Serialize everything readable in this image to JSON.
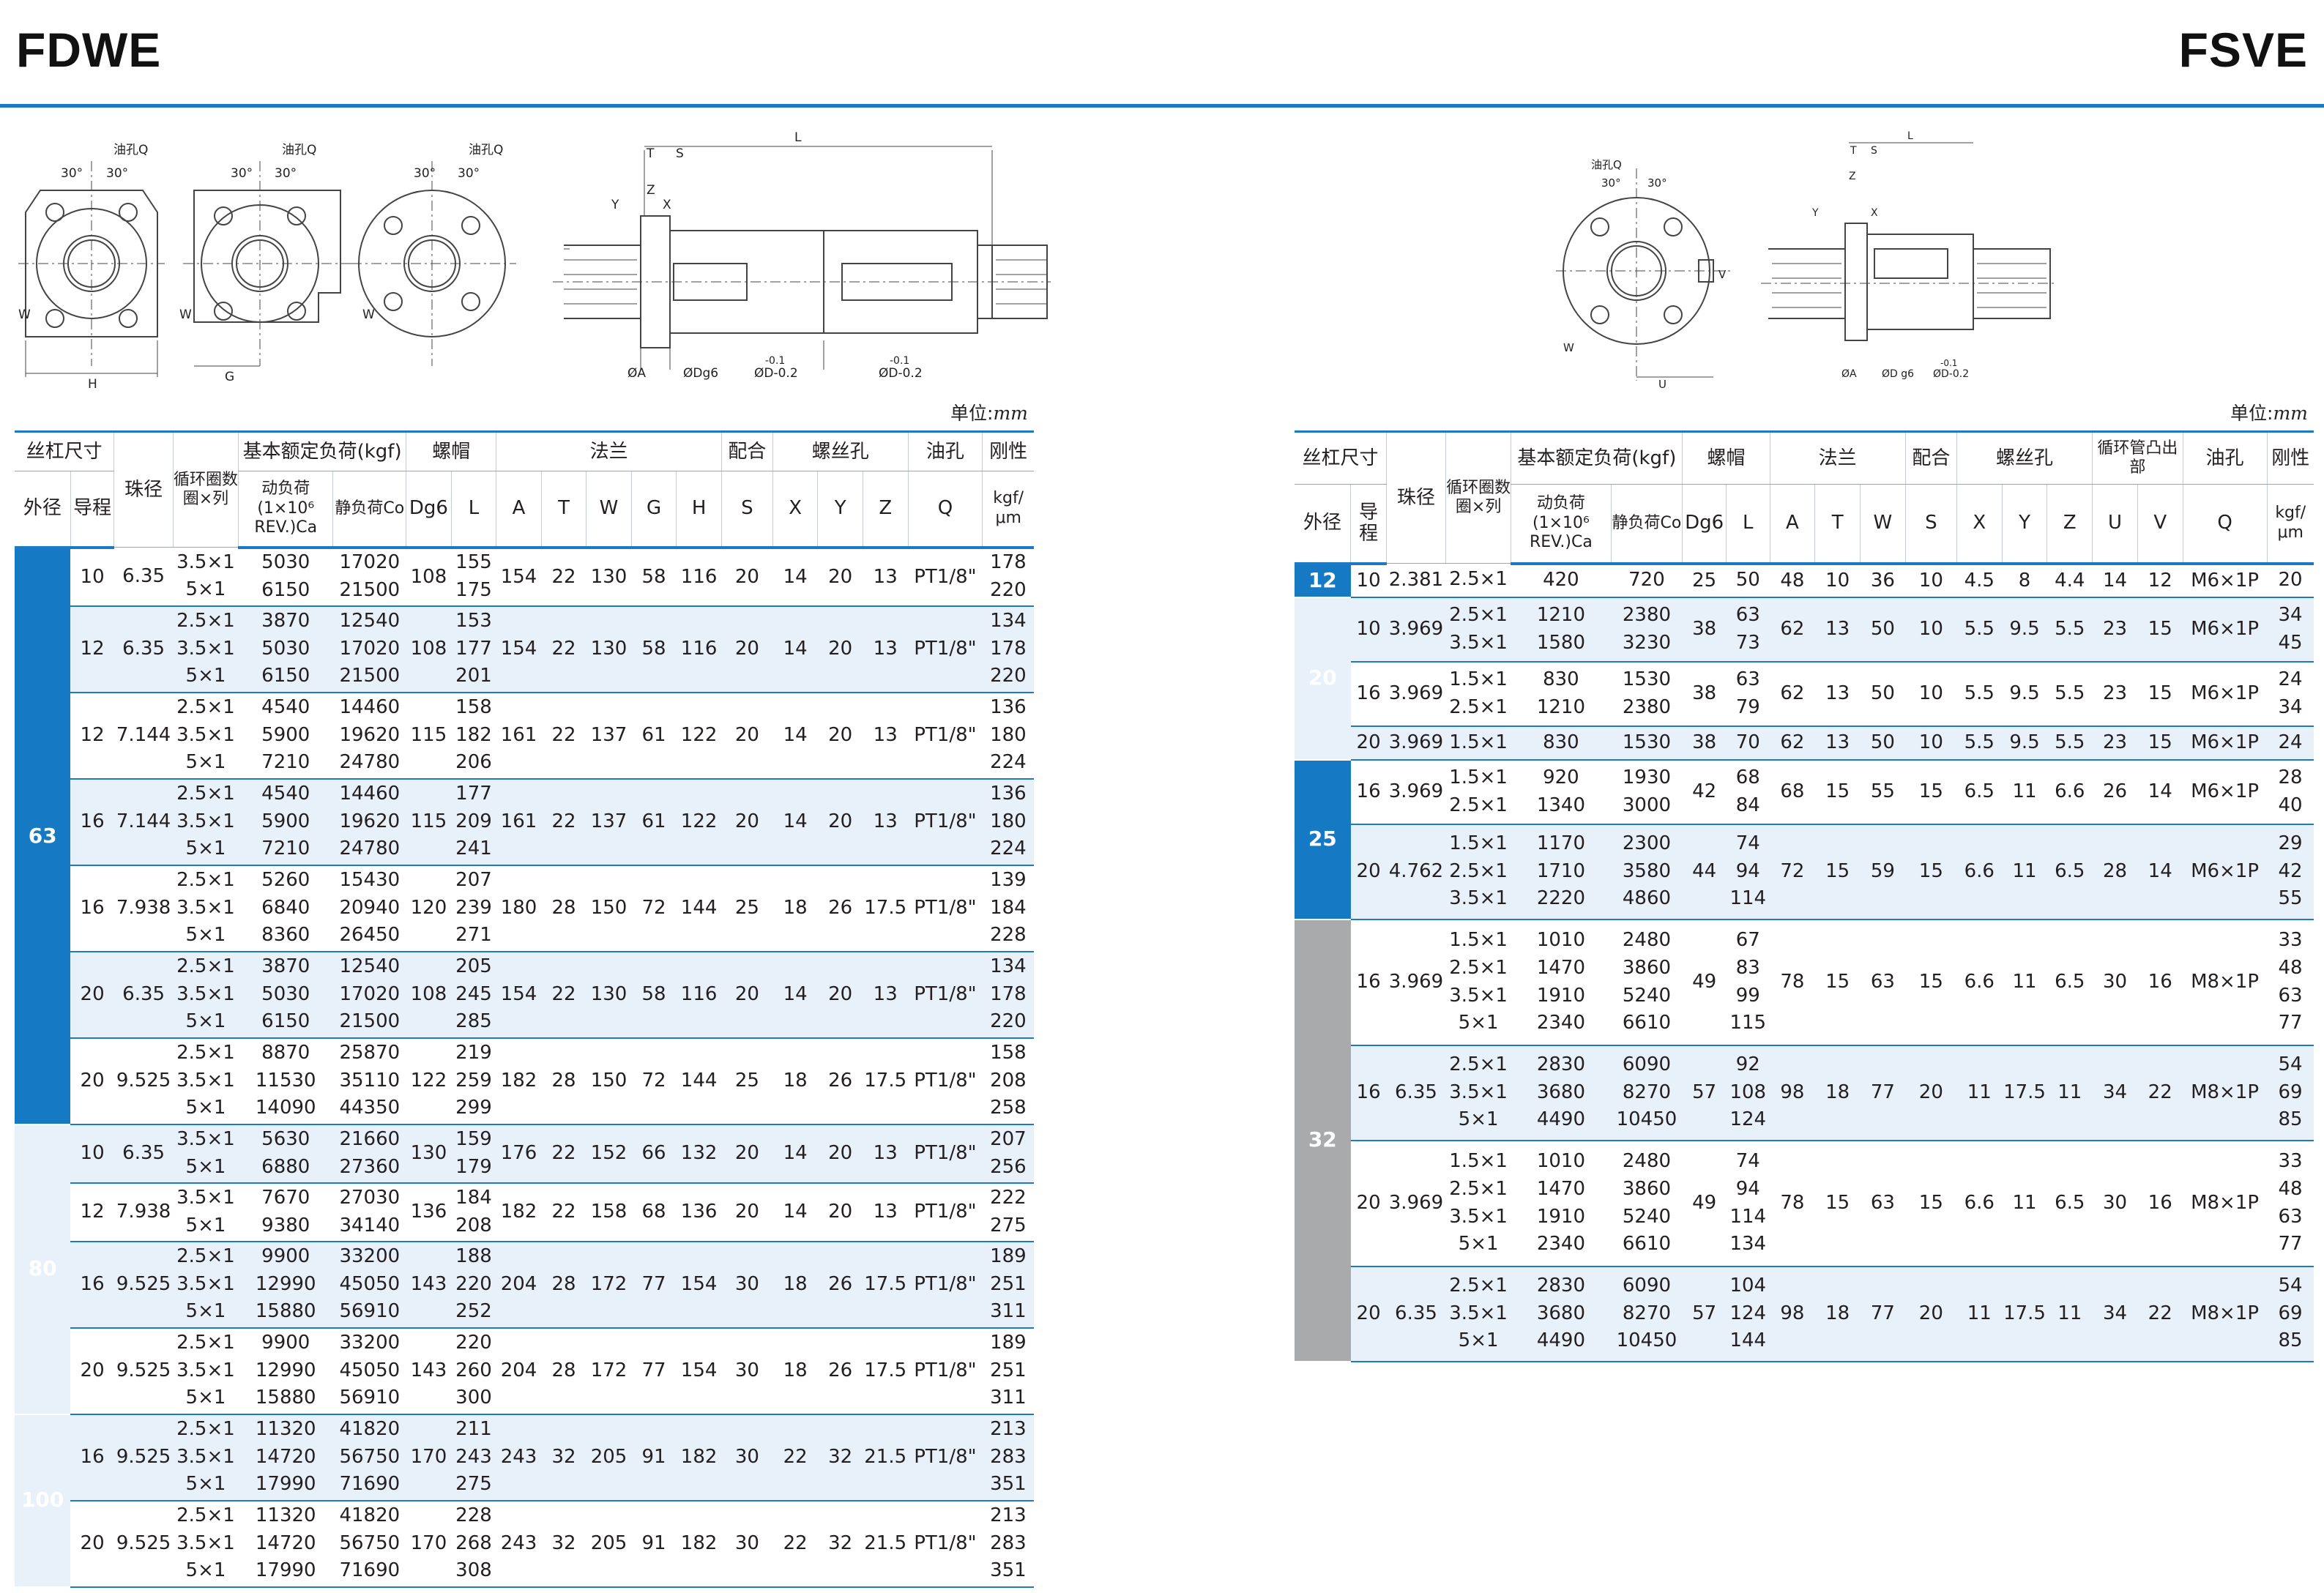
{
  "titles": {
    "left": "FDWE",
    "right": "FSVE"
  },
  "unit": {
    "label": "单位:",
    "value": "mm"
  },
  "drawing_labels": {
    "oil_hole": "油孔Q",
    "angle": "30°",
    "W": "W",
    "H": "H",
    "G": "G",
    "L": "L",
    "T": "T",
    "S": "S",
    "Z": "Z",
    "Y": "Y",
    "X": "X",
    "U": "U",
    "V": "V",
    "phiA": "ØA",
    "phiDg6": "ØDg6",
    "phiDg6_right": "ØD g6",
    "phiD": "ØD-0.2",
    "tol": "-0.1"
  },
  "header_left": {
    "screw": "丝杠尺寸",
    "od": "外径",
    "lead": "导程",
    "ball": "珠径",
    "circ": "循环圈数圈×列",
    "load": "基本额定负荷(kgf)",
    "dyn": "动负荷(1×10⁶ REV.)Ca",
    "stat": "静负荷Co",
    "nut": "螺帽",
    "Dg6": "Dg6",
    "L": "L",
    "flange": "法兰",
    "A": "A",
    "T": "T",
    "W": "W",
    "G": "G",
    "H": "H",
    "fit": "配合",
    "S": "S",
    "bolt": "螺丝孔",
    "X": "X",
    "Y": "Y",
    "Z": "Z",
    "oil": "油孔",
    "Q": "Q",
    "rig": "刚性",
    "rigu": "kgf/μm"
  },
  "header_right": {
    "screw": "丝杠尺寸",
    "od": "外径",
    "lead": "导程",
    "ball": "珠径",
    "circ": "循环圈数圈×列",
    "load": "基本额定负荷(kgf)",
    "dyn": "动负荷(1×10⁶ REV.)Ca",
    "stat": "静负荷Co",
    "nut": "螺帽",
    "Dg6": "Dg6",
    "L": "L",
    "flange": "法兰",
    "A": "A",
    "T": "T",
    "W": "W",
    "fit": "配合",
    "S": "S",
    "bolt": "螺丝孔",
    "X": "X",
    "Y": "Y",
    "Z": "Z",
    "ret": "循环管凸出部",
    "U": "U",
    "V": "V",
    "oil": "油孔",
    "Q": "Q",
    "rig": "刚性",
    "rigu": "kgf/μm"
  },
  "fdwe_groups": [
    {
      "od": "63",
      "color": "blue",
      "rows": [
        {
          "lead": "10",
          "ball": "6.35",
          "circ": [
            "3.5×1",
            "5×1"
          ],
          "ca": [
            "5030",
            "6150"
          ],
          "co": [
            "17020",
            "21500"
          ],
          "D": "108",
          "L": [
            "155",
            "175"
          ],
          "A": "154",
          "T": "22",
          "W": "130",
          "G": "58",
          "H": "116",
          "S": "20",
          "X": "14",
          "Y": "20",
          "Z": "13",
          "Q": "PT1/8\"",
          "K": [
            "178",
            "220"
          ]
        },
        {
          "lead": "12",
          "ball": "6.35",
          "circ": [
            "2.5×1",
            "3.5×1",
            "5×1"
          ],
          "ca": [
            "3870",
            "5030",
            "6150"
          ],
          "co": [
            "12540",
            "17020",
            "21500"
          ],
          "D": "108",
          "L": [
            "153",
            "177",
            "201"
          ],
          "A": "154",
          "T": "22",
          "W": "130",
          "G": "58",
          "H": "116",
          "S": "20",
          "X": "14",
          "Y": "20",
          "Z": "13",
          "Q": "PT1/8\"",
          "K": [
            "134",
            "178",
            "220"
          ]
        },
        {
          "lead": "12",
          "ball": "7.144",
          "circ": [
            "2.5×1",
            "3.5×1",
            "5×1"
          ],
          "ca": [
            "4540",
            "5900",
            "7210"
          ],
          "co": [
            "14460",
            "19620",
            "24780"
          ],
          "D": "115",
          "L": [
            "158",
            "182",
            "206"
          ],
          "A": "161",
          "T": "22",
          "W": "137",
          "G": "61",
          "H": "122",
          "S": "20",
          "X": "14",
          "Y": "20",
          "Z": "13",
          "Q": "PT1/8\"",
          "K": [
            "136",
            "180",
            "224"
          ]
        },
        {
          "lead": "16",
          "ball": "7.144",
          "circ": [
            "2.5×1",
            "3.5×1",
            "5×1"
          ],
          "ca": [
            "4540",
            "5900",
            "7210"
          ],
          "co": [
            "14460",
            "19620",
            "24780"
          ],
          "D": "115",
          "L": [
            "177",
            "209",
            "241"
          ],
          "A": "161",
          "T": "22",
          "W": "137",
          "G": "61",
          "H": "122",
          "S": "20",
          "X": "14",
          "Y": "20",
          "Z": "13",
          "Q": "PT1/8\"",
          "K": [
            "136",
            "180",
            "224"
          ]
        },
        {
          "lead": "16",
          "ball": "7.938",
          "circ": [
            "2.5×1",
            "3.5×1",
            "5×1"
          ],
          "ca": [
            "5260",
            "6840",
            "8360"
          ],
          "co": [
            "15430",
            "20940",
            "26450"
          ],
          "D": "120",
          "L": [
            "207",
            "239",
            "271"
          ],
          "A": "180",
          "T": "28",
          "W": "150",
          "G": "72",
          "H": "144",
          "S": "25",
          "X": "18",
          "Y": "26",
          "Z": "17.5",
          "Q": "PT1/8\"",
          "K": [
            "139",
            "184",
            "228"
          ]
        },
        {
          "lead": "20",
          "ball": "6.35",
          "circ": [
            "2.5×1",
            "3.5×1",
            "5×1"
          ],
          "ca": [
            "3870",
            "5030",
            "6150"
          ],
          "co": [
            "12540",
            "17020",
            "21500"
          ],
          "D": "108",
          "L": [
            "205",
            "245",
            "285"
          ],
          "A": "154",
          "T": "22",
          "W": "130",
          "G": "58",
          "H": "116",
          "S": "20",
          "X": "14",
          "Y": "20",
          "Z": "13",
          "Q": "PT1/8\"",
          "K": [
            "134",
            "178",
            "220"
          ]
        },
        {
          "lead": "20",
          "ball": "9.525",
          "circ": [
            "2.5×1",
            "3.5×1",
            "5×1"
          ],
          "ca": [
            "8870",
            "11530",
            "14090"
          ],
          "co": [
            "25870",
            "35110",
            "44350"
          ],
          "D": "122",
          "L": [
            "219",
            "259",
            "299"
          ],
          "A": "182",
          "T": "28",
          "W": "150",
          "G": "72",
          "H": "144",
          "S": "25",
          "X": "18",
          "Y": "26",
          "Z": "17.5",
          "Q": "PT1/8\"",
          "K": [
            "158",
            "208",
            "258"
          ]
        }
      ]
    },
    {
      "od": "80",
      "color": "gray",
      "rows": [
        {
          "lead": "10",
          "ball": "6.35",
          "circ": [
            "3.5×1",
            "5×1"
          ],
          "ca": [
            "5630",
            "6880"
          ],
          "co": [
            "21660",
            "27360"
          ],
          "D": "130",
          "L": [
            "159",
            "179"
          ],
          "A": "176",
          "T": "22",
          "W": "152",
          "G": "66",
          "H": "132",
          "S": "20",
          "X": "14",
          "Y": "20",
          "Z": "13",
          "Q": "PT1/8\"",
          "K": [
            "207",
            "256"
          ]
        },
        {
          "lead": "12",
          "ball": "7.938",
          "circ": [
            "3.5×1",
            "5×1"
          ],
          "ca": [
            "7670",
            "9380"
          ],
          "co": [
            "27030",
            "34140"
          ],
          "D": "136",
          "L": [
            "184",
            "208"
          ],
          "A": "182",
          "T": "22",
          "W": "158",
          "G": "68",
          "H": "136",
          "S": "20",
          "X": "14",
          "Y": "20",
          "Z": "13",
          "Q": "PT1/8\"",
          "K": [
            "222",
            "275"
          ]
        },
        {
          "lead": "16",
          "ball": "9.525",
          "circ": [
            "2.5×1",
            "3.5×1",
            "5×1"
          ],
          "ca": [
            "9900",
            "12990",
            "15880"
          ],
          "co": [
            "33200",
            "45050",
            "56910"
          ],
          "D": "143",
          "L": [
            "188",
            "220",
            "252"
          ],
          "A": "204",
          "T": "28",
          "W": "172",
          "G": "77",
          "H": "154",
          "S": "30",
          "X": "18",
          "Y": "26",
          "Z": "17.5",
          "Q": "PT1/8\"",
          "K": [
            "189",
            "251",
            "311"
          ]
        },
        {
          "lead": "20",
          "ball": "9.525",
          "circ": [
            "2.5×1",
            "3.5×1",
            "5×1"
          ],
          "ca": [
            "9900",
            "12990",
            "15880"
          ],
          "co": [
            "33200",
            "45050",
            "56910"
          ],
          "D": "143",
          "L": [
            "220",
            "260",
            "300"
          ],
          "A": "204",
          "T": "28",
          "W": "172",
          "G": "77",
          "H": "154",
          "S": "30",
          "X": "18",
          "Y": "26",
          "Z": "17.5",
          "Q": "PT1/8\"",
          "K": [
            "189",
            "251",
            "311"
          ]
        }
      ]
    },
    {
      "od": "100",
      "color": "blue",
      "rows": [
        {
          "lead": "16",
          "ball": "9.525",
          "circ": [
            "2.5×1",
            "3.5×1",
            "5×1"
          ],
          "ca": [
            "11320",
            "14720",
            "17990"
          ],
          "co": [
            "41820",
            "56750",
            "71690"
          ],
          "D": "170",
          "L": [
            "211",
            "243",
            "275"
          ],
          "A": "243",
          "T": "32",
          "W": "205",
          "G": "91",
          "H": "182",
          "S": "30",
          "X": "22",
          "Y": "32",
          "Z": "21.5",
          "Q": "PT1/8\"",
          "K": [
            "213",
            "283",
            "351"
          ]
        },
        {
          "lead": "20",
          "ball": "9.525",
          "circ": [
            "2.5×1",
            "3.5×1",
            "5×1"
          ],
          "ca": [
            "11320",
            "14720",
            "17990"
          ],
          "co": [
            "41820",
            "56750",
            "71690"
          ],
          "D": "170",
          "L": [
            "228",
            "268",
            "308"
          ],
          "A": "243",
          "T": "32",
          "W": "205",
          "G": "91",
          "H": "182",
          "S": "30",
          "X": "22",
          "Y": "32",
          "Z": "21.5",
          "Q": "PT1/8\"",
          "K": [
            "213",
            "283",
            "351"
          ]
        }
      ]
    }
  ],
  "fsve_groups": [
    {
      "od": "12",
      "color": "blue",
      "rows": [
        {
          "lead": "10",
          "ball": "2.381",
          "circ": [
            "2.5×1"
          ],
          "ca": [
            "420"
          ],
          "co": [
            "720"
          ],
          "D": "25",
          "L": [
            "50"
          ],
          "A": "48",
          "T": "10",
          "W": "36",
          "S": "10",
          "X": "4.5",
          "Y": "8",
          "Z": "4.4",
          "U": "14",
          "V": "12",
          "Q": "M6×1P",
          "K": [
            "20"
          ]
        }
      ]
    },
    {
      "od": "20",
      "color": "gray",
      "rows": [
        {
          "lead": "10",
          "ball": "3.969",
          "circ": [
            "2.5×1",
            "3.5×1"
          ],
          "ca": [
            "1210",
            "1580"
          ],
          "co": [
            "2380",
            "3230"
          ],
          "D": "38",
          "L": [
            "63",
            "73"
          ],
          "A": "62",
          "T": "13",
          "W": "50",
          "S": "10",
          "X": "5.5",
          "Y": "9.5",
          "Z": "5.5",
          "U": "23",
          "V": "15",
          "Q": "M6×1P",
          "K": [
            "34",
            "45"
          ]
        },
        {
          "lead": "16",
          "ball": "3.969",
          "circ": [
            "1.5×1",
            "2.5×1"
          ],
          "ca": [
            "830",
            "1210"
          ],
          "co": [
            "1530",
            "2380"
          ],
          "D": "38",
          "L": [
            "63",
            "79"
          ],
          "A": "62",
          "T": "13",
          "W": "50",
          "S": "10",
          "X": "5.5",
          "Y": "9.5",
          "Z": "5.5",
          "U": "23",
          "V": "15",
          "Q": "M6×1P",
          "K": [
            "24",
            "34"
          ]
        },
        {
          "lead": "20",
          "ball": "3.969",
          "circ": [
            "1.5×1"
          ],
          "ca": [
            "830"
          ],
          "co": [
            "1530"
          ],
          "D": "38",
          "L": [
            "70"
          ],
          "A": "62",
          "T": "13",
          "W": "50",
          "S": "10",
          "X": "5.5",
          "Y": "9.5",
          "Z": "5.5",
          "U": "23",
          "V": "15",
          "Q": "M6×1P",
          "K": [
            "24"
          ]
        }
      ]
    },
    {
      "od": "25",
      "color": "blue",
      "rows": [
        {
          "lead": "16",
          "ball": "3.969",
          "circ": [
            "1.5×1",
            "2.5×1"
          ],
          "ca": [
            "920",
            "1340"
          ],
          "co": [
            "1930",
            "3000"
          ],
          "D": "42",
          "L": [
            "68",
            "84"
          ],
          "A": "68",
          "T": "15",
          "W": "55",
          "S": "15",
          "X": "6.5",
          "Y": "11",
          "Z": "6.6",
          "U": "26",
          "V": "14",
          "Q": "M6×1P",
          "K": [
            "28",
            "40"
          ]
        },
        {
          "lead": "20",
          "ball": "4.762",
          "circ": [
            "1.5×1",
            "2.5×1",
            "3.5×1"
          ],
          "ca": [
            "1170",
            "1710",
            "2220"
          ],
          "co": [
            "2300",
            "3580",
            "4860"
          ],
          "D": "44",
          "L": [
            "74",
            "94",
            "114"
          ],
          "A": "72",
          "T": "15",
          "W": "59",
          "S": "15",
          "X": "6.6",
          "Y": "11",
          "Z": "6.5",
          "U": "28",
          "V": "14",
          "Q": "M6×1P",
          "K": [
            "29",
            "42",
            "55"
          ]
        }
      ]
    },
    {
      "od": "32",
      "color": "gray",
      "rows": [
        {
          "lead": "16",
          "ball": "3.969",
          "circ": [
            "1.5×1",
            "2.5×1",
            "3.5×1",
            "5×1"
          ],
          "ca": [
            "1010",
            "1470",
            "1910",
            "2340"
          ],
          "co": [
            "2480",
            "3860",
            "5240",
            "6610"
          ],
          "D": "49",
          "L": [
            "67",
            "83",
            "99",
            "115"
          ],
          "A": "78",
          "T": "15",
          "W": "63",
          "S": "15",
          "X": "6.6",
          "Y": "11",
          "Z": "6.5",
          "U": "30",
          "V": "16",
          "Q": "M8×1P",
          "K": [
            "33",
            "48",
            "63",
            "77"
          ]
        },
        {
          "lead": "16",
          "ball": "6.35",
          "circ": [
            "2.5×1",
            "3.5×1",
            "5×1"
          ],
          "ca": [
            "2830",
            "3680",
            "4490"
          ],
          "co": [
            "6090",
            "8270",
            "10450"
          ],
          "D": "57",
          "L": [
            "92",
            "108",
            "124"
          ],
          "A": "98",
          "T": "18",
          "W": "77",
          "S": "20",
          "X": "11",
          "Y": "17.5",
          "Z": "11",
          "U": "34",
          "V": "22",
          "Q": "M8×1P",
          "K": [
            "54",
            "69",
            "85"
          ]
        },
        {
          "lead": "20",
          "ball": "3.969",
          "circ": [
            "1.5×1",
            "2.5×1",
            "3.5×1",
            "5×1"
          ],
          "ca": [
            "1010",
            "1470",
            "1910",
            "2340"
          ],
          "co": [
            "2480",
            "3860",
            "5240",
            "6610"
          ],
          "D": "49",
          "L": [
            "74",
            "94",
            "114",
            "134"
          ],
          "A": "78",
          "T": "15",
          "W": "63",
          "S": "15",
          "X": "6.6",
          "Y": "11",
          "Z": "6.5",
          "U": "30",
          "V": "16",
          "Q": "M8×1P",
          "K": [
            "33",
            "48",
            "63",
            "77"
          ]
        },
        {
          "lead": "20",
          "ball": "6.35",
          "circ": [
            "2.5×1",
            "3.5×1",
            "5×1"
          ],
          "ca": [
            "2830",
            "3680",
            "4490"
          ],
          "co": [
            "6090",
            "8270",
            "10450"
          ],
          "D": "57",
          "L": [
            "104",
            "124",
            "144"
          ],
          "A": "98",
          "T": "18",
          "W": "77",
          "S": "20",
          "X": "11",
          "Y": "17.5",
          "Z": "11",
          "U": "34",
          "V": "22",
          "Q": "M8×1P",
          "K": [
            "54",
            "69",
            "85"
          ]
        }
      ]
    }
  ]
}
